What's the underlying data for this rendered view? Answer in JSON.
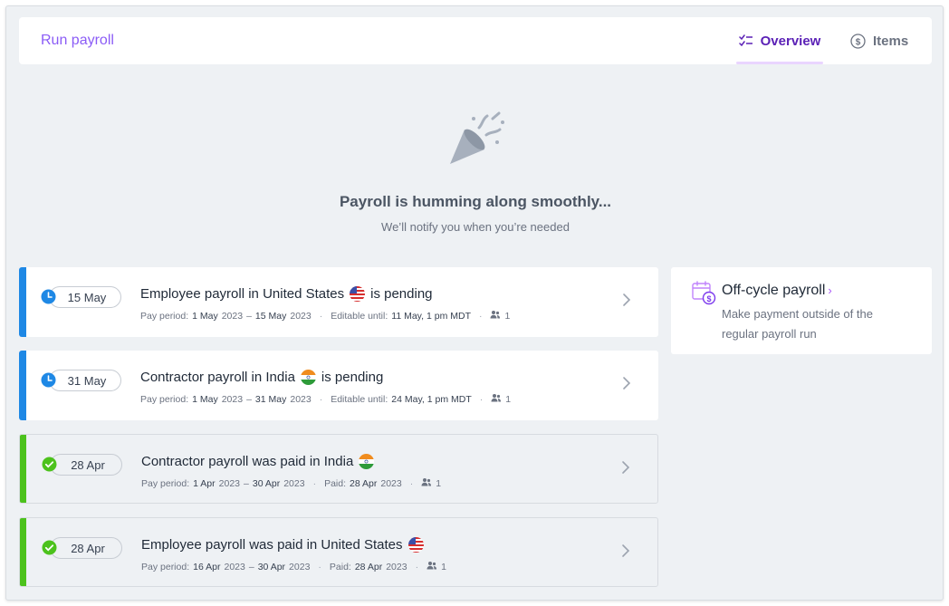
{
  "header": {
    "title": "Run payroll",
    "tabs": [
      {
        "label": "Overview",
        "icon": "checklist-icon",
        "active": true
      },
      {
        "label": "Items",
        "icon": "dollar-circle-icon",
        "active": false
      }
    ]
  },
  "hero": {
    "icon": "party-popper-icon",
    "title": "Payroll is humming along smoothly...",
    "subtitle": "We’ll notify you when you’re needed"
  },
  "payrolls": [
    {
      "status": "pending",
      "date": "15 May",
      "title": "Employee payroll in United States",
      "suffix": "is pending",
      "flag": "us-flag-icon",
      "period_label": "Pay period:",
      "period_start": "1 May",
      "period_start_year": "2023",
      "period_end": "15 May",
      "period_end_year": "2023",
      "second_label": "Editable until:",
      "second_value": "11 May, 1 pm MDT",
      "people_count": "1"
    },
    {
      "status": "pending",
      "date": "31 May",
      "title": "Contractor payroll in India",
      "suffix": "is pending",
      "flag": "india-flag-icon",
      "period_label": "Pay period:",
      "period_start": "1 May",
      "period_start_year": "2023",
      "period_end": "31 May",
      "period_end_year": "2023",
      "second_label": "Editable until:",
      "second_value": "24 May, 1 pm MDT",
      "people_count": "1"
    },
    {
      "status": "paid",
      "date": "28 Apr",
      "title": "Contractor payroll was paid in India",
      "suffix": "",
      "flag": "india-flag-icon",
      "period_label": "Pay period:",
      "period_start": "1 Apr",
      "period_start_year": "2023",
      "period_end": "30 Apr",
      "period_end_year": "2023",
      "second_label": "Paid:",
      "second_value": "28 Apr",
      "second_value_year": "2023",
      "people_count": "1"
    },
    {
      "status": "paid",
      "date": "28 Apr",
      "title": "Employee payroll was paid in United States",
      "suffix": "",
      "flag": "us-flag-icon",
      "period_label": "Pay period:",
      "period_start": "16 Apr",
      "period_start_year": "2023",
      "period_end": "30 Apr",
      "period_end_year": "2023",
      "second_label": "Paid:",
      "second_value": "28 Apr",
      "second_value_year": "2023",
      "people_count": "1"
    }
  ],
  "offcycle": {
    "title": "Off-cycle payroll",
    "description": "Make payment outside of the regular payroll run",
    "icon": "calendar-dollar-icon"
  },
  "colors": {
    "accent": "#8b5cf6",
    "pending": "#1e88e5",
    "paid": "#4cc21c"
  }
}
